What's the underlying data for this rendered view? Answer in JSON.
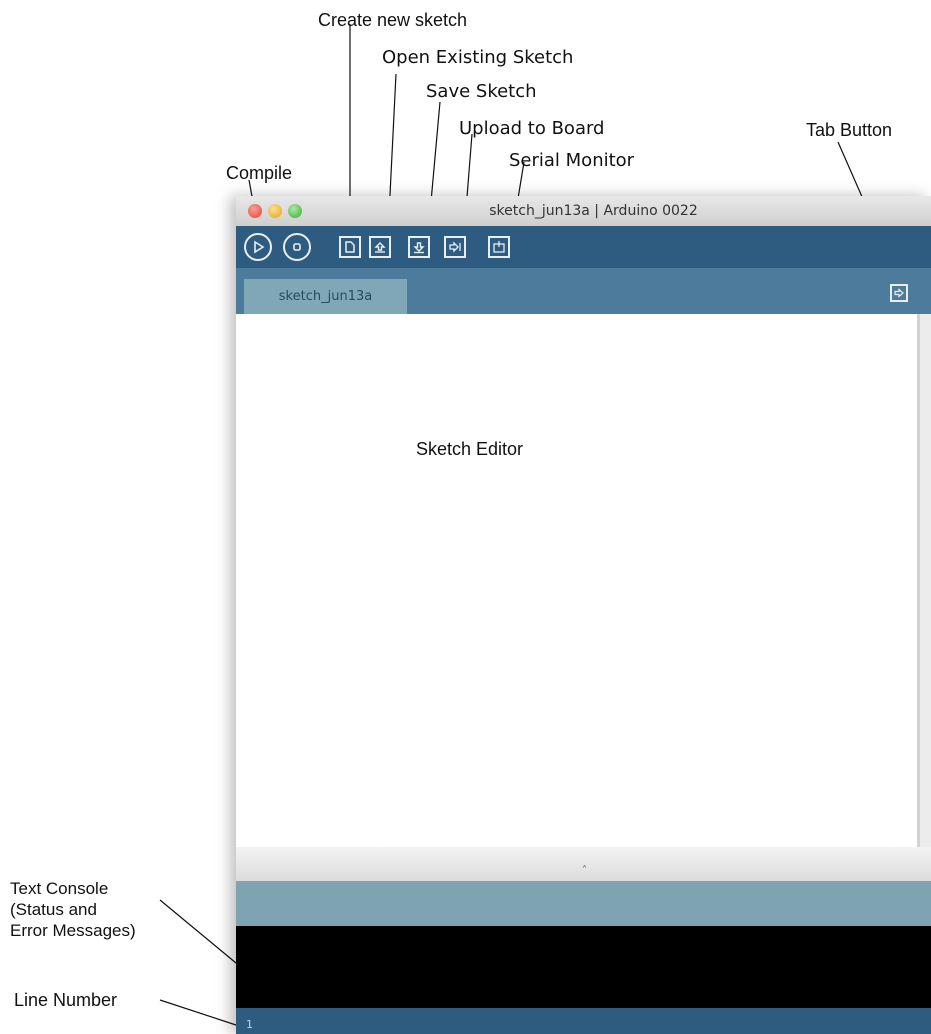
{
  "annotations": {
    "create_new": "Create new sketch",
    "open_existing": "Open Existing Sketch",
    "save": "Save Sketch",
    "upload": "Upload to Board",
    "serial_monitor": "Serial Monitor",
    "tab_button": "Tab Button",
    "compile": "Compile",
    "sketch_editor": "Sketch Editor",
    "text_console_1": "Text Console",
    "text_console_2": "(Status and",
    "text_console_3": "Error Messages)",
    "line_number": "Line Number"
  },
  "window": {
    "title": "sketch_jun13a | Arduino 0022"
  },
  "tabs": [
    {
      "label": "sketch_jun13a"
    }
  ],
  "footer": {
    "line_number": "1"
  },
  "toolbar": {
    "buttons": [
      "play-icon",
      "stop-icon",
      "new-file-icon",
      "open-icon",
      "save-icon",
      "upload-icon",
      "serial-monitor-icon"
    ]
  },
  "colors": {
    "toolbar": "#2e5c80",
    "tabbar": "#4d7b9c",
    "tab_active": "#7fa7b5",
    "status": "#7fa4b1",
    "console": "#000000"
  }
}
